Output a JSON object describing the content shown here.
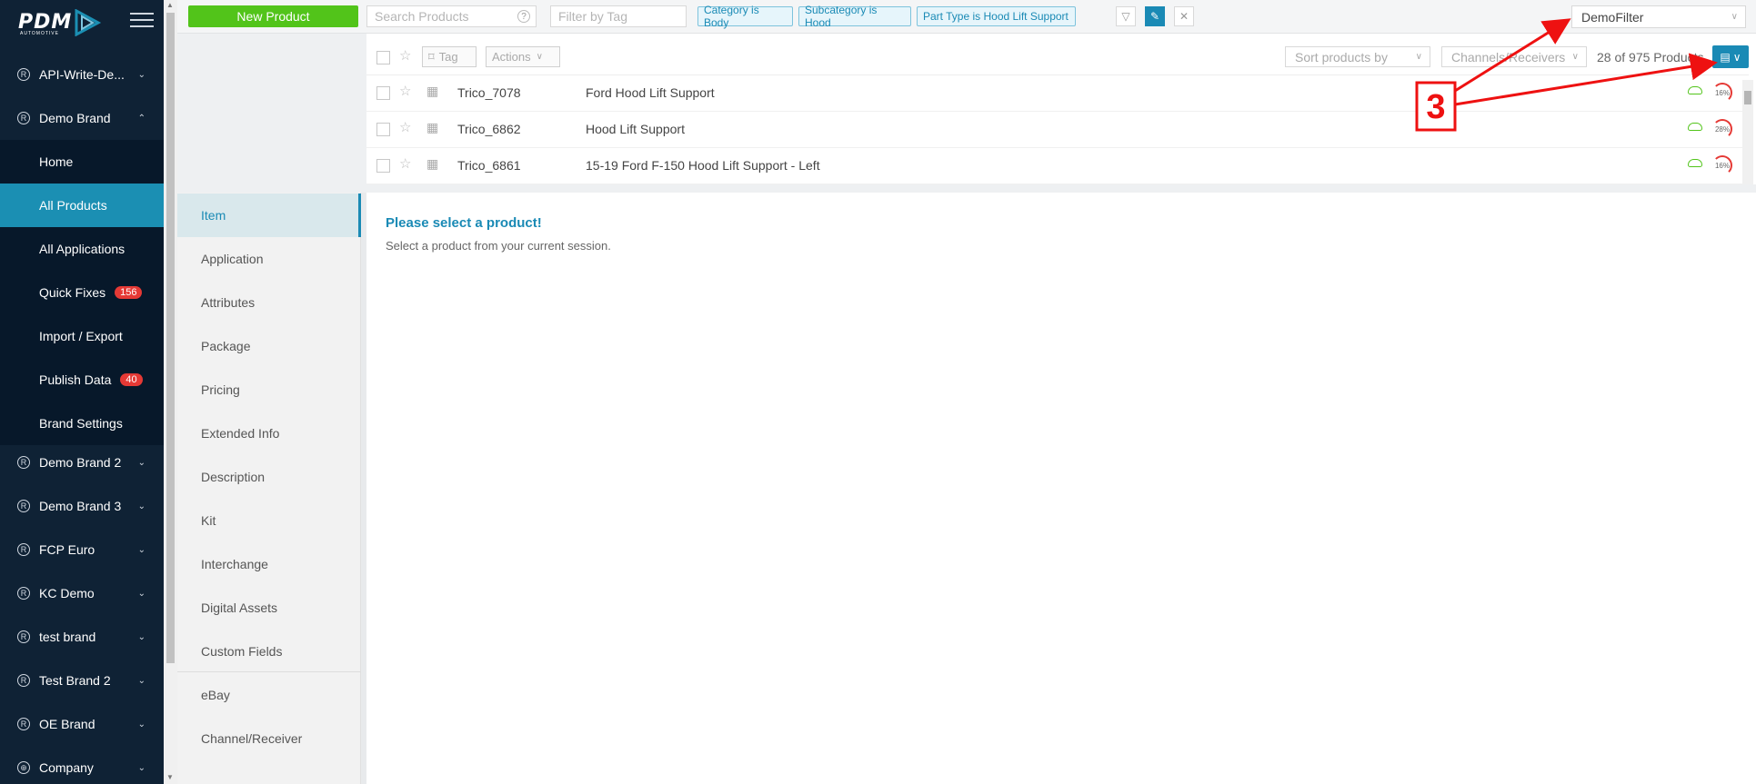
{
  "sidebar": {
    "logo_text": "PDM",
    "logo_sub": "AUTOMOTIVE",
    "items": [
      {
        "label": "API-Write-De...",
        "type": "brand",
        "expanded": false
      },
      {
        "label": "Demo Brand",
        "type": "brand",
        "expanded": true
      },
      {
        "label": "Home",
        "type": "sub"
      },
      {
        "label": "All Products",
        "type": "sub",
        "active": true
      },
      {
        "label": "All Applications",
        "type": "sub"
      },
      {
        "label": "Quick Fixes",
        "type": "sub",
        "badge": "156"
      },
      {
        "label": "Import / Export",
        "type": "sub"
      },
      {
        "label": "Publish Data",
        "type": "sub",
        "badge": "40"
      },
      {
        "label": "Brand Settings",
        "type": "sub"
      },
      {
        "label": "Demo Brand 2",
        "type": "brand"
      },
      {
        "label": "Demo Brand 3",
        "type": "brand"
      },
      {
        "label": "FCP Euro",
        "type": "brand"
      },
      {
        "label": "KC Demo",
        "type": "brand"
      },
      {
        "label": "test brand",
        "type": "brand"
      },
      {
        "label": "Test Brand 2",
        "type": "brand"
      },
      {
        "label": "OE Brand",
        "type": "brand"
      },
      {
        "label": "Company",
        "type": "company"
      }
    ]
  },
  "topbar": {
    "new_product": "New Product",
    "search_placeholder": "Search Products",
    "tag_placeholder": "Filter by Tag",
    "filters": [
      "Category is Body",
      "Subcategory is Hood",
      "Part Type is Hood Lift Support"
    ],
    "saved_filter": "DemoFilter"
  },
  "products": {
    "tag_label": "Tag",
    "actions_label": "Actions",
    "sort_placeholder": "Sort products by",
    "channels_placeholder": "Channels/Receivers",
    "count": "28 of 975 Products",
    "rows": [
      {
        "code": "Trico_7078",
        "name": "Ford Hood Lift Support",
        "pct": "16%"
      },
      {
        "code": "Trico_6862",
        "name": "Hood Lift Support",
        "pct": "28%"
      },
      {
        "code": "Trico_6861",
        "name": "15-19 Ford F-150 Hood Lift Support - Left",
        "pct": "16%"
      }
    ]
  },
  "tabs": [
    "Item",
    "Application",
    "Attributes",
    "Package",
    "Pricing",
    "Extended Info",
    "Description",
    "Kit",
    "Interchange",
    "Digital Assets",
    "Custom Fields",
    "eBay",
    "Channel/Receiver"
  ],
  "message": {
    "title": "Please select a product!",
    "body": "Select a product from your current session."
  },
  "annotation": {
    "label": "3",
    "color": "#ee1111"
  },
  "colors": {
    "sidebar_bg": "#0f2235",
    "active_blue": "#1b8fb3",
    "green": "#52c41a",
    "badge_red": "#e53935"
  }
}
